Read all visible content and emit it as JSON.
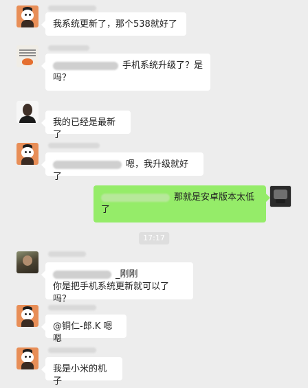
{
  "messages": [
    {
      "text": "我系统更新了，那个538就好了"
    },
    {
      "text": "手机系统升级了？是吗？"
    },
    {
      "text": "我的已经是最新了"
    },
    {
      "text": "嗯，我升级就好了"
    },
    {
      "text": "那就是安卓版本太低了"
    },
    {
      "mention_suffix": "_刚刚",
      "text": "你是把手机系统更新就可以了吗？"
    },
    {
      "text": "@铜仁-郎.K 嗯嗯"
    },
    {
      "text": "我是小米的机子"
    }
  ],
  "timestamp": "17:17"
}
